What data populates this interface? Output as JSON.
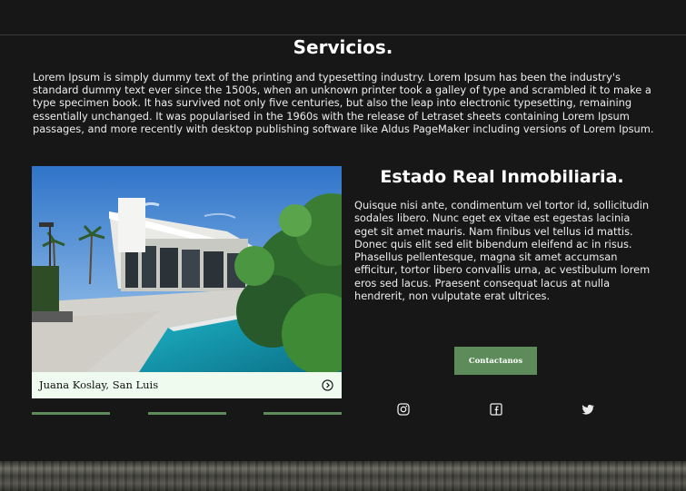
{
  "section": {
    "title": "Servicios.",
    "intro": "Lorem Ipsum is simply dummy text of the printing and typesetting industry. Lorem Ipsum has been the industry's standard dummy text ever since the 1500s, when an unknown printer took a galley of type and scrambled it to make a type specimen book. It has survived not only five centuries, but also the leap into electronic typesetting, remaining essentially unchanged. It was popularised in the 1960s with the release of Letraset sheets containing Lorem Ipsum passages, and more recently with desktop publishing software like Aldus PageMaker including versions of Lorem Ipsum."
  },
  "property_card": {
    "caption": "Juana Koslay, San Luis",
    "caption_icon": "chevron-right-circle-icon"
  },
  "about": {
    "title": "Estado Real Inmobiliaria.",
    "description": "Quisque nisi ante, condimentum vel tortor id, sollicitudin sodales libero. Nunc eget ex vitae est egestas lacinia eget sit amet mauris. Nam finibus vel tellus id mattis. Donec quis elit sed elit bibendum eleifend ac in risus. Phasellus pellentesque, magna sit amet accumsan efficitur, tortor libero convallis urna, ac vestibulum lorem eros sed lacus. Praesent consequat lacus at nulla hendrerit, non vulputate erat ultrices.",
    "cta_label": "Contactanos"
  },
  "social": {
    "instagram": "instagram-icon",
    "facebook": "facebook-icon",
    "twitter": "twitter-icon"
  },
  "colors": {
    "background": "#171717",
    "accent": "#5d8c5a",
    "caption_bg": "#eefbee"
  }
}
